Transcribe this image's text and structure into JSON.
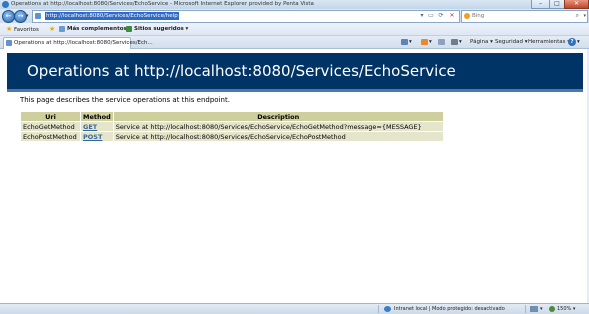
{
  "window": {
    "title": "Operations at http://localhost:8080/Services/EchoService - Microsoft Internet Explorer provided by Penta Vista",
    "buttons": {
      "minimize": "–",
      "maximize": "□",
      "close": "✕"
    }
  },
  "navigation": {
    "back_icon": "back-arrow-icon",
    "forward_icon": "forward-arrow-icon",
    "url": "http://localhost:8080/Services/EchoService/help",
    "compat_icon": "compatibility-view-icon",
    "refresh_icon": "refresh-icon",
    "stop_icon": "stop-icon",
    "search_placeholder": "Bing",
    "search_icon": "search-magnifier-icon"
  },
  "favorites_bar": {
    "favorites_label": "Favoritos",
    "more_addons_label": "Más complementos",
    "suggested_sites_label": "Sitios sugeridos"
  },
  "tabs": [
    {
      "label": "Operations at http://localhost:8080/Services/Ech..."
    }
  ],
  "command_bar": {
    "page_label": "Página",
    "safety_label": "Seguridad",
    "tools_label": "Herramientas",
    "help_label": "?"
  },
  "page": {
    "heading": "Operations at http://localhost:8080/Services/EchoService",
    "intro": "This page describes the service operations at this endpoint.",
    "table": {
      "headers": [
        "Uri",
        "Method",
        "Description"
      ],
      "rows": [
        {
          "uri": "EchoGetMethod",
          "method": "GET",
          "description": "Service at http://localhost:8080/Services/EchoService/EchoGetMethod?message={MESSAGE}"
        },
        {
          "uri": "EchoPostMethod",
          "method": "POST",
          "description": "Service at http://localhost:8080/Services/EchoService/EchoPostMethod"
        }
      ]
    }
  },
  "status_bar": {
    "zone_text": "Intranet local | Modo protegido: desactivado",
    "zoom": "150%"
  },
  "colors": {
    "banner_background": "#003366",
    "table_header": "#cecf9c",
    "table_cell": "#e5e5cc",
    "link": "#336699",
    "url_selection": "#3169c6"
  }
}
